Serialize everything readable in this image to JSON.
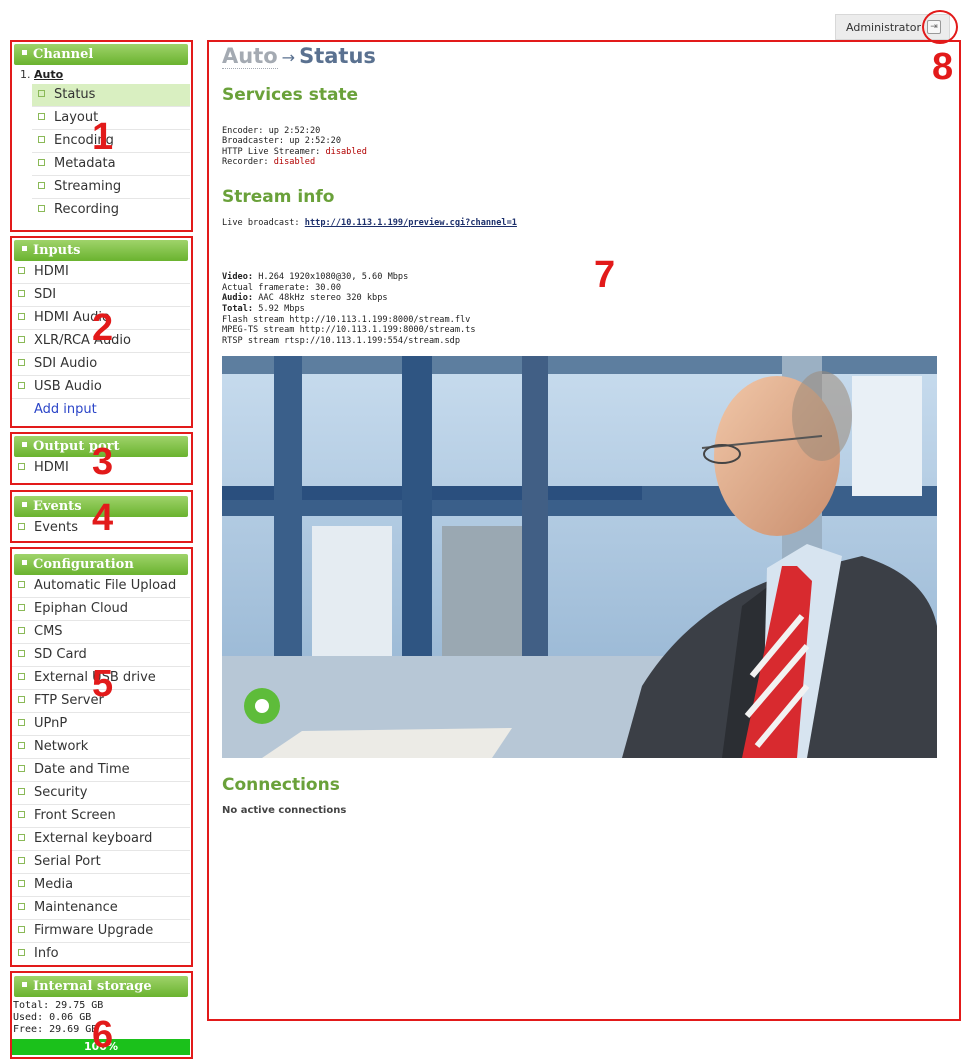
{
  "admin": {
    "user_label": "Administrator",
    "logout_icon": "logout-icon"
  },
  "callout_labels": [
    "1",
    "2",
    "3",
    "4",
    "5",
    "6",
    "7",
    "8"
  ],
  "sidebar": {
    "channel": {
      "title": "Channel",
      "channel_index": "1.",
      "channel_name": "Auto",
      "items": [
        {
          "label": "Status",
          "active": true
        },
        {
          "label": "Layout"
        },
        {
          "label": "Encoding"
        },
        {
          "label": "Metadata"
        },
        {
          "label": "Streaming"
        },
        {
          "label": "Recording"
        }
      ]
    },
    "inputs": {
      "title": "Inputs",
      "items": [
        {
          "label": "HDMI"
        },
        {
          "label": "SDI"
        },
        {
          "label": "HDMI Audio"
        },
        {
          "label": "XLR/RCA Audio"
        },
        {
          "label": "SDI Audio"
        },
        {
          "label": "USB Audio"
        }
      ],
      "add_label": "Add input"
    },
    "output_port": {
      "title": "Output port",
      "items": [
        {
          "label": "HDMI"
        }
      ]
    },
    "events": {
      "title": "Events",
      "items": [
        {
          "label": "Events"
        }
      ]
    },
    "configuration": {
      "title": "Configuration",
      "items": [
        {
          "label": "Automatic File Upload"
        },
        {
          "label": "Epiphan Cloud"
        },
        {
          "label": "CMS"
        },
        {
          "label": "SD Card"
        },
        {
          "label": "External USB drive"
        },
        {
          "label": "FTP Server"
        },
        {
          "label": "UPnP"
        },
        {
          "label": "Network"
        },
        {
          "label": "Date and Time"
        },
        {
          "label": "Security"
        },
        {
          "label": "Front Screen"
        },
        {
          "label": "External keyboard"
        },
        {
          "label": "Serial Port"
        },
        {
          "label": "Media"
        },
        {
          "label": "Maintenance"
        },
        {
          "label": "Firmware Upgrade"
        },
        {
          "label": "Info"
        }
      ]
    },
    "storage": {
      "title": "Internal storage",
      "total": "Total: 29.75 GB",
      "used": "Used: 0.06 GB",
      "free": "Free: 29.69 GB",
      "free_percent_label": "100%",
      "free_fraction": 1.0
    }
  },
  "main": {
    "breadcrumb_parent": "Auto",
    "breadcrumb_arrow": "→",
    "page_title": "Status",
    "services": {
      "title": "Services state",
      "encoder_label": "Encoder: ",
      "encoder_value": "up 2:52:20",
      "broadcaster_label": "Broadcaster: ",
      "broadcaster_value": "up 2:52:20",
      "hls_label": "HTTP Live Streamer: ",
      "hls_value": "disabled",
      "recorder_label": "Recorder: ",
      "recorder_value": "disabled"
    },
    "stream_info": {
      "title": "Stream info",
      "live_label": "Live broadcast: ",
      "live_url": "http://10.113.1.199/preview.cgi?channel=1",
      "video_label": "Video:",
      "video_value": " H.264 1920x1080@30, 5.60 Mbps",
      "framerate": "Actual framerate: 30.00",
      "audio_label": "Audio:",
      "audio_value": " AAC 48kHz stereo 320 kbps",
      "total_label": "Total:",
      "total_value": " 5.92 Mbps",
      "flash": "Flash stream http://10.113.1.199:8000/stream.flv",
      "mpegts": "MPEG-TS stream http://10.113.1.199:8000/stream.ts",
      "rtsp": "RTSP stream rtsp://10.113.1.199:554/stream.sdp"
    },
    "connections": {
      "title": "Connections",
      "status": "No active connections"
    }
  },
  "colors": {
    "accent_green": "#6ab32f",
    "callout_red": "#e21a1a",
    "title_blue": "#5a7190",
    "progress_green": "#1bc11b"
  }
}
